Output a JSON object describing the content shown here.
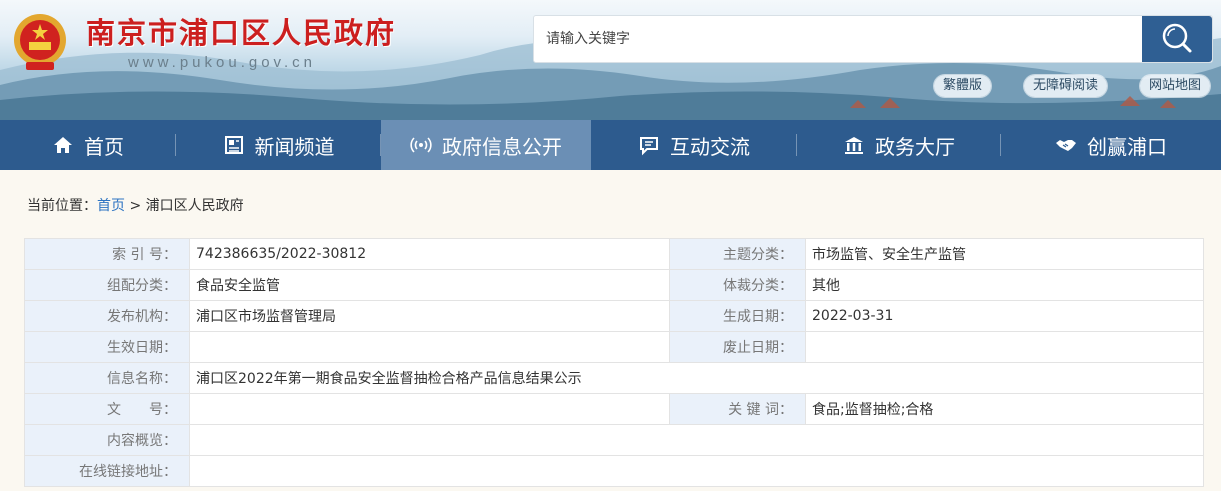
{
  "header": {
    "site_title": "南京市浦口区人民政府",
    "site_url": "www.pukou.gov.cn"
  },
  "search": {
    "placeholder": "请输入关键字",
    "icon": "search-icon"
  },
  "quick_links": [
    "繁體版",
    "无障碍阅读",
    "网站地图"
  ],
  "nav": {
    "items": [
      {
        "label": "首页",
        "icon": "home-icon"
      },
      {
        "label": "新闻频道",
        "icon": "news-icon"
      },
      {
        "label": "政府信息公开",
        "icon": "broadcast-icon"
      },
      {
        "label": "互动交流",
        "icon": "chat-icon"
      },
      {
        "label": "政务大厅",
        "icon": "hall-icon"
      },
      {
        "label": "创赢浦口",
        "icon": "handshake-icon"
      }
    ],
    "active_index": 2
  },
  "breadcrumb": {
    "prefix": "当前位置：",
    "home": "首页",
    "separator": ">",
    "current": "浦口区人民政府"
  },
  "info": {
    "index_label": "索 引 号：",
    "index_value": "742386635/2022-30812",
    "theme_label": "主题分类：",
    "theme_value": "市场监管、安全生产监管",
    "group_label": "组配分类：",
    "group_value": "食品安全监管",
    "genre_label": "体裁分类：",
    "genre_value": "其他",
    "publisher_label": "发布机构：",
    "publisher_value": "浦口区市场监督管理局",
    "created_label": "生成日期：",
    "created_value": "2022-03-31",
    "effective_label": "生效日期：",
    "effective_value": "",
    "expire_label": "废止日期：",
    "expire_value": "",
    "name_label": "信息名称：",
    "name_value": "浦口区2022年第一期食品安全监督抽检合格产品信息结果公示",
    "docno_label": "文　　号：",
    "docno_value": "",
    "keywords_label": "关 键 词：",
    "keywords_value": "食品;监督抽检;合格",
    "summary_label": "内容概览：",
    "summary_value": "",
    "link_label": "在线链接地址：",
    "link_value": ""
  },
  "colors": {
    "nav_bg": "#2d5b8e",
    "nav_active": "#6b8fb5",
    "title_red": "#cc1f1f",
    "label_bg": "#eaf1fa",
    "link_blue": "#2d73c2"
  }
}
